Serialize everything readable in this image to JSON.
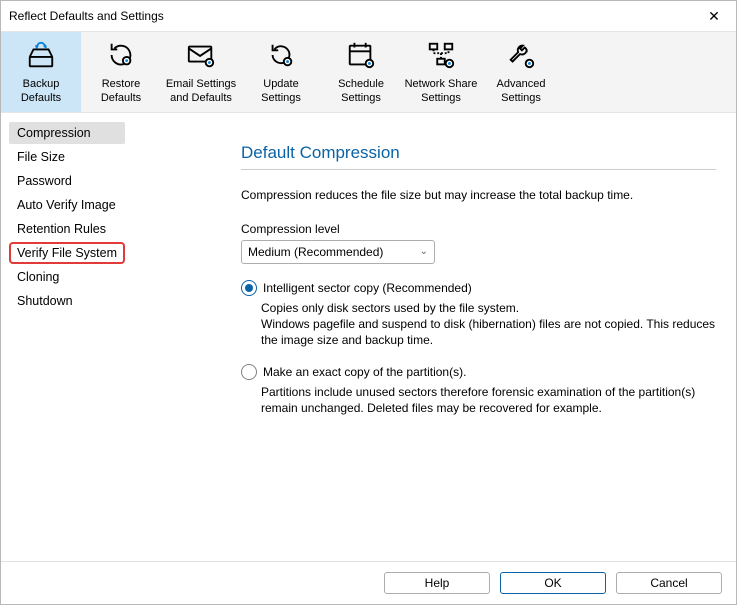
{
  "window": {
    "title": "Reflect Defaults and Settings"
  },
  "toolbar": [
    {
      "id": "backup-defaults",
      "label1": "Backup",
      "label2": "Defaults",
      "selected": true
    },
    {
      "id": "restore-defaults",
      "label1": "Restore",
      "label2": "Defaults",
      "selected": false
    },
    {
      "id": "email-settings",
      "label1": "Email Settings",
      "label2": "and Defaults",
      "selected": false
    },
    {
      "id": "update-settings",
      "label1": "Update",
      "label2": "Settings",
      "selected": false
    },
    {
      "id": "schedule-settings",
      "label1": "Schedule",
      "label2": "Settings",
      "selected": false
    },
    {
      "id": "network-share",
      "label1": "Network Share",
      "label2": "Settings",
      "selected": false
    },
    {
      "id": "advanced-settings",
      "label1": "Advanced",
      "label2": "Settings",
      "selected": false
    }
  ],
  "sidebar": [
    {
      "id": "compression",
      "label": "Compression",
      "selected": true,
      "highlight": false
    },
    {
      "id": "file-size",
      "label": "File Size",
      "selected": false,
      "highlight": false
    },
    {
      "id": "password",
      "label": "Password",
      "selected": false,
      "highlight": false
    },
    {
      "id": "auto-verify",
      "label": "Auto Verify Image",
      "selected": false,
      "highlight": false
    },
    {
      "id": "retention-rules",
      "label": "Retention Rules",
      "selected": false,
      "highlight": false
    },
    {
      "id": "verify-file-system",
      "label": "Verify File System",
      "selected": false,
      "highlight": true
    },
    {
      "id": "cloning",
      "label": "Cloning",
      "selected": false,
      "highlight": false
    },
    {
      "id": "shutdown",
      "label": "Shutdown",
      "selected": false,
      "highlight": false
    }
  ],
  "main": {
    "heading": "Default Compression",
    "intro": "Compression reduces the file size but may increase the total backup time.",
    "level_label": "Compression level",
    "level_value": "Medium (Recommended)",
    "opt1": {
      "label": "Intelligent sector copy (Recommended)",
      "desc1": "Copies only disk sectors used by the file system.",
      "desc2": "Windows pagefile and suspend to disk (hibernation) files are not copied. This reduces the image size and backup time."
    },
    "opt2": {
      "label": "Make an exact copy of the partition(s).",
      "desc": "Partitions include unused sectors therefore forensic examination of the partition(s) remain unchanged. Deleted files may be recovered for example."
    }
  },
  "footer": {
    "help": "Help",
    "ok": "OK",
    "cancel": "Cancel"
  }
}
